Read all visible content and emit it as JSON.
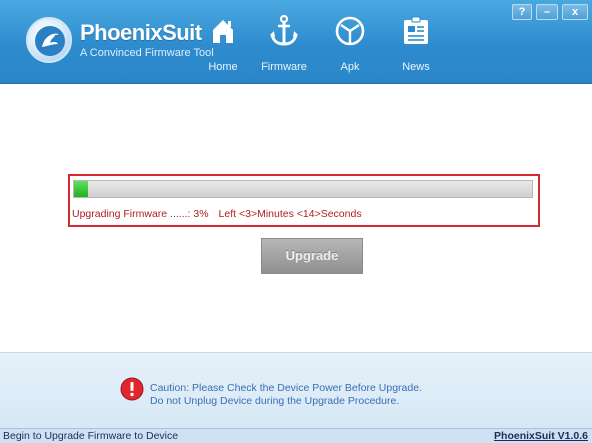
{
  "app": {
    "name": "PhoenixSuit",
    "tagline": "A Convinced Firmware Tool"
  },
  "window_controls": {
    "help": "?",
    "minimize": "–",
    "close": "x"
  },
  "nav": {
    "items": [
      {
        "label": "Home",
        "icon": "home-icon"
      },
      {
        "label": "Firmware",
        "icon": "anchor-icon"
      },
      {
        "label": "Apk",
        "icon": "apk-icon"
      },
      {
        "label": "News",
        "icon": "news-icon"
      }
    ],
    "active": "Firmware"
  },
  "progress": {
    "status_label": "Upgrading Firmware ......: 3%",
    "time_left": "Left <3>Minutes <14>Seconds",
    "percent": 3
  },
  "upgrade_button": {
    "label": "Upgrade",
    "enabled": false
  },
  "caution": {
    "line1": "Caution: Please Check the Device Power Before Upgrade.",
    "line2": "Do not Unplug Device during the Upgrade Procedure."
  },
  "statusbar": {
    "message": "Begin to Upgrade Firmware to Device",
    "version": "PhoenixSuit V1.0.6"
  },
  "colors": {
    "header_blue": "#2e8cce",
    "highlight_red": "#d42a34",
    "progress_green": "#1fb01f",
    "caution_text": "#3a6fb2"
  }
}
